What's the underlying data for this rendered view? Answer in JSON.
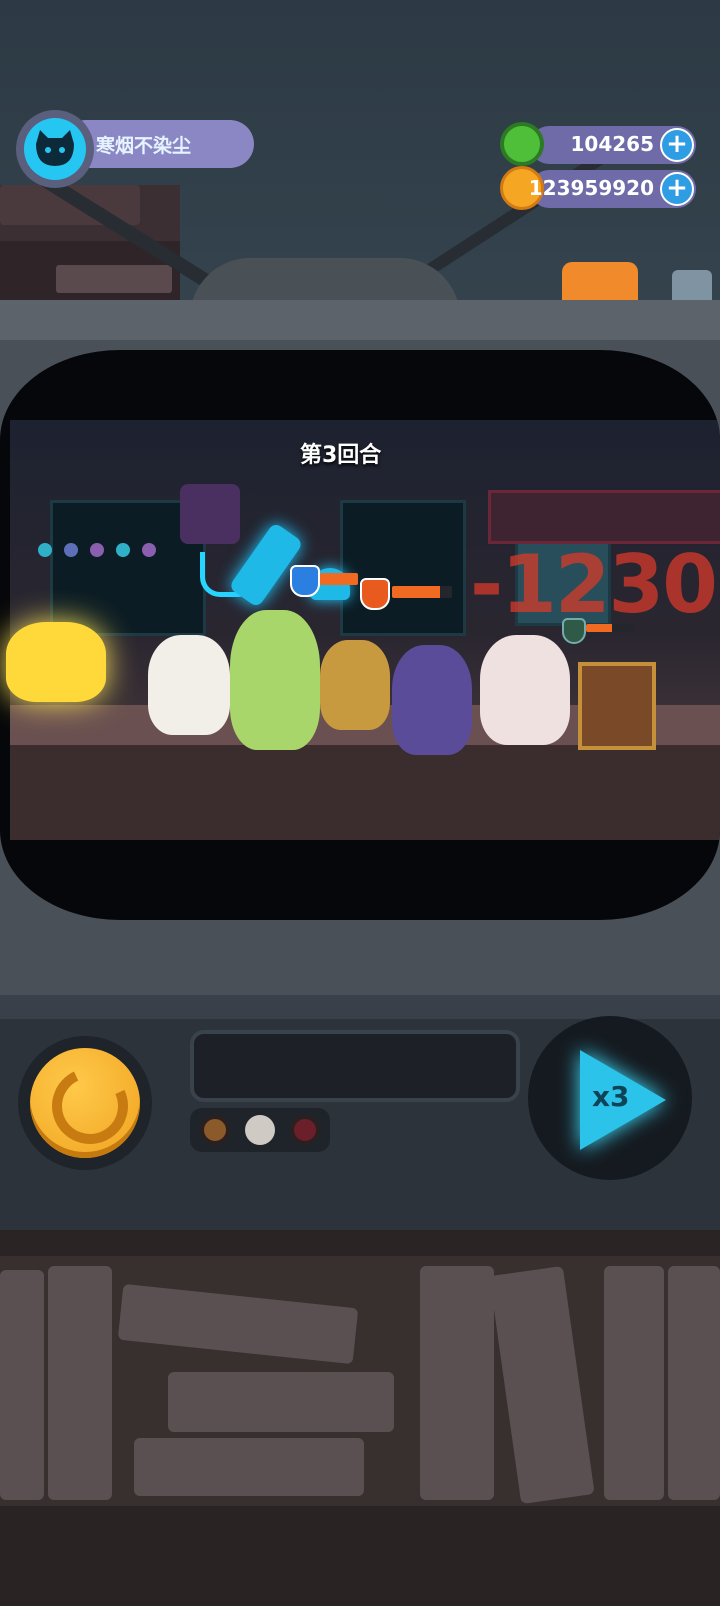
{
  "player": {
    "name": "寒烟不染尘",
    "avatar_icon": "cat-icon"
  },
  "currencies": [
    {
      "id": "donut",
      "icon": "green-donut-icon",
      "value": "104265",
      "plus_label": "+"
    },
    {
      "id": "planet",
      "icon": "orange-planet-icon",
      "value": "123959920",
      "plus_label": "+"
    }
  ],
  "battle": {
    "round_label": "第3回合",
    "damage_text": "-1230"
  },
  "controls": {
    "speed_label": "x3",
    "reload_icon": "refresh-icon",
    "speed_icon": "play-fast-icon"
  },
  "colors": {
    "accent_cyan": "#2bc3ea",
    "gold": "#f5b42a",
    "hp_orange": "#f06a22",
    "damage_red": "#d63a2a"
  }
}
